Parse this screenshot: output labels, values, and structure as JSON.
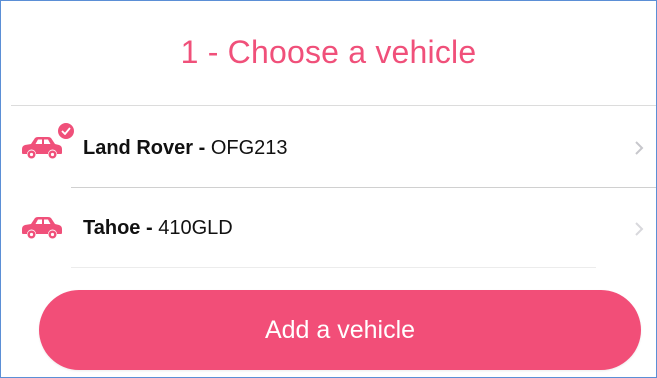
{
  "title": "1 - Choose a vehicle",
  "vehicles": [
    {
      "name": "Land Rover",
      "separator": " - ",
      "plate": "OFG213",
      "selected": true,
      "icon": "car-icon"
    },
    {
      "name": "Tahoe",
      "separator": " - ",
      "plate": "410GLD",
      "selected": false,
      "icon": "car-icon"
    }
  ],
  "add_button": {
    "label": "Add a vehicle"
  },
  "colors": {
    "accent": "#f0507a",
    "button": "#f24e78",
    "frame_border": "#5b8fd6"
  }
}
